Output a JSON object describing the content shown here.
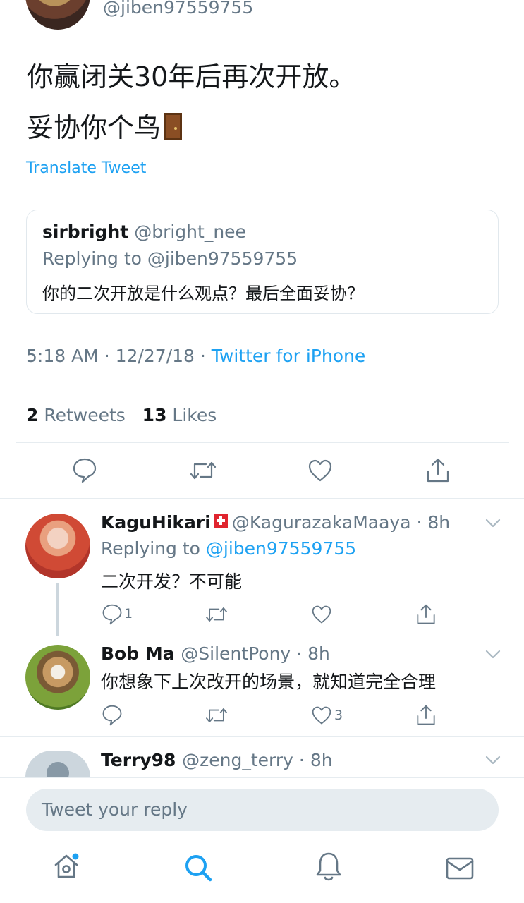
{
  "tweet": {
    "handle": "@jiben97559755",
    "line1": "你赢闭关30年后再次开放。",
    "line2": "妥协你个鸟",
    "translate": "Translate Tweet",
    "quoted": {
      "name": "sirbright",
      "handle": "@bright_nee",
      "replying": "Replying to @jiben97559755",
      "text": "你的二次开放是什么观点？最后全面妥协？"
    },
    "time": "5:18 AM",
    "date": "12/27/18",
    "source": "Twitter for iPhone",
    "retweets_count": "2",
    "retweets_label": "Retweets",
    "likes_count": "13",
    "likes_label": "Likes"
  },
  "replies": [
    {
      "name": "KaguHikari",
      "handle": "@KagurazakaMaaya",
      "time": "8h",
      "replying_prefix": "Replying to",
      "replying_handle": "@jiben97559755",
      "text": "二次开发？不可能",
      "reply_count": "1",
      "like_count": ""
    },
    {
      "name": "Bob Ma",
      "handle": "@SilentPony",
      "time": "8h",
      "text": "你想象下上次改开的场景，就知道完全合理",
      "reply_count": "",
      "like_count": "3"
    },
    {
      "name": "Terry98",
      "handle": "@zeng_terry",
      "time": "8h"
    }
  ],
  "composer": {
    "placeholder": "Tweet your reply"
  },
  "colors": {
    "accent": "#1da1f2",
    "secondary_text": "#657786",
    "divider": "#e6ecf0"
  },
  "icons": {
    "actions": [
      "reply-icon",
      "retweet-icon",
      "like-icon",
      "share-icon"
    ],
    "tabs": [
      "home-icon",
      "search-icon",
      "notifications-icon",
      "messages-icon"
    ]
  }
}
